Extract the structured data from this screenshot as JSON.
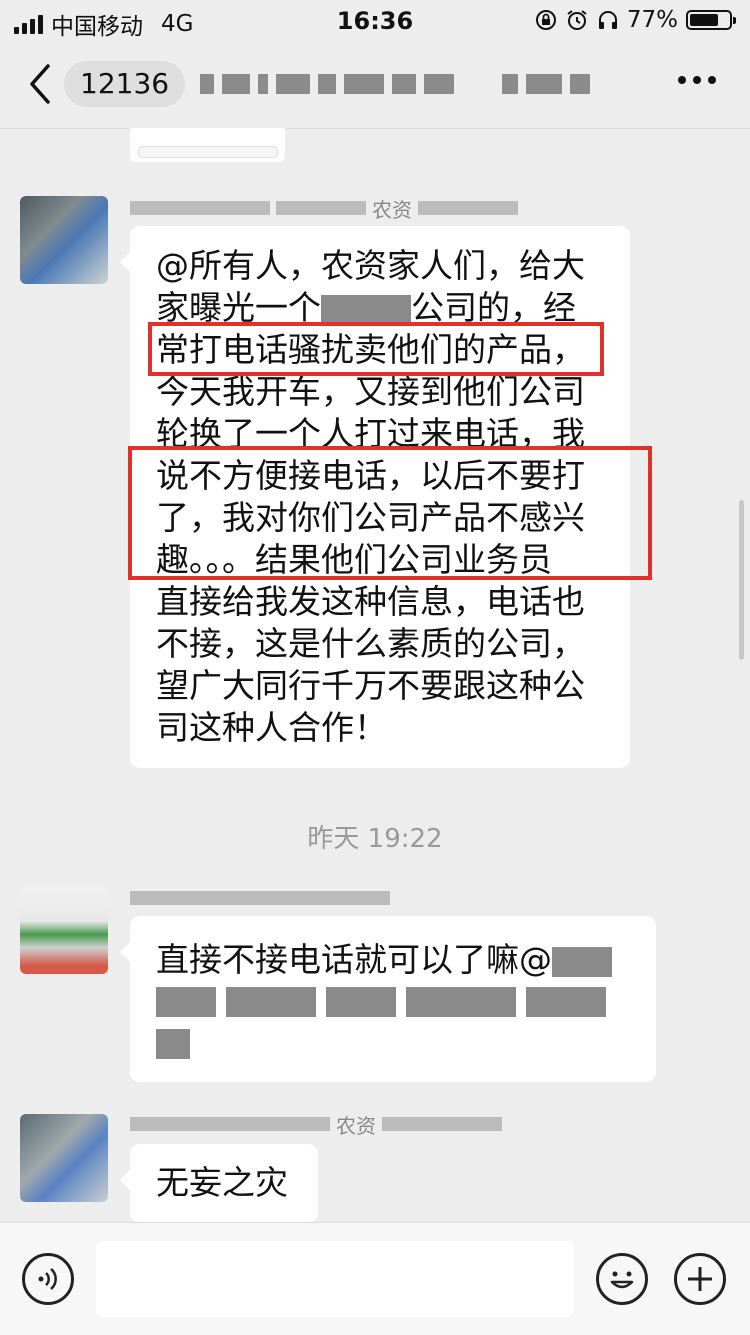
{
  "status_bar": {
    "carrier": "中国移动",
    "network": "4G",
    "time": "16:36",
    "battery_percent": "77%",
    "battery_level": 0.77
  },
  "nav": {
    "back_icon": "chevron-left-icon",
    "unread_count": "12136",
    "more_icon": "more-dots-icon"
  },
  "messages": [
    {
      "sender_fragment": "农资",
      "lines": [
        "@所有人，农资家人们，给大",
        "家曝光一个",
        "公司的，经",
        "常打电话骚扰卖他们的产品，",
        "今天我开车，又接到他们公司",
        "轮换了一个人打过来电话，我",
        "说不方便接电话，以后不要打",
        "了，我对你们公司产品不感兴",
        "趣。。。结果他们公司业务员",
        "直接给我发这种信息，电话也",
        "不接，这是什么素质的公司，",
        "望广大同行千万不要跟这种公",
        "司这种人合作！"
      ]
    },
    {
      "text": "直接不接电话就可以了嘛@"
    },
    {
      "sender_fragment": "农资",
      "text": "无妄之灾"
    }
  ],
  "timestamp": "昨天 19:22",
  "input_bar": {
    "voice_icon": "voice-icon",
    "emoji_icon": "emoji-icon",
    "plus_icon": "plus-icon"
  },
  "colors": {
    "background": "#ededed",
    "bubble": "#ffffff",
    "highlight": "#e0322b"
  }
}
